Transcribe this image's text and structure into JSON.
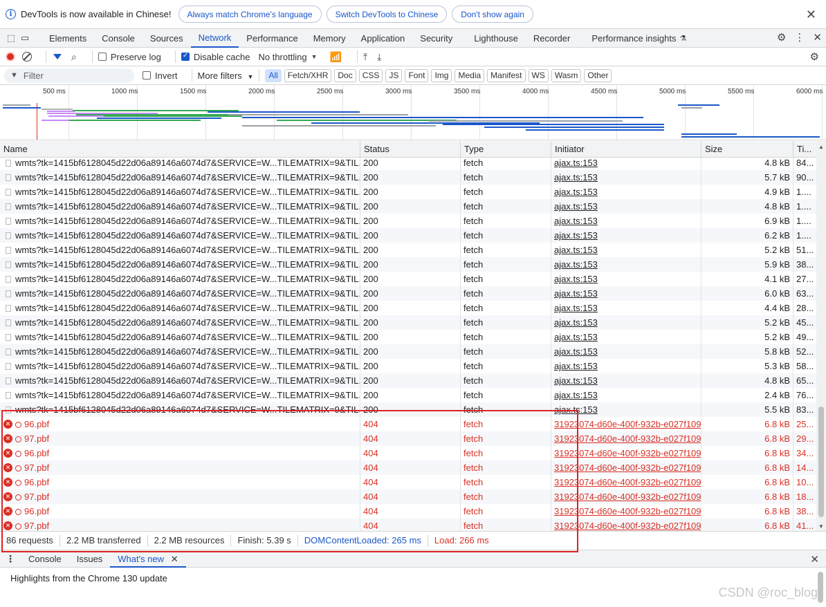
{
  "infobar": {
    "message": "DevTools is now available in Chinese!",
    "buttons": [
      "Always match Chrome's language",
      "Switch DevTools to Chinese",
      "Don't show again"
    ]
  },
  "main_tabs": [
    "Elements",
    "Console",
    "Sources",
    "Network",
    "Performance",
    "Memory",
    "Application",
    "Security",
    "Lighthouse",
    "Recorder",
    "Performance insights"
  ],
  "active_main_tab": "Network",
  "toolbar": {
    "preserve_log": "Preserve log",
    "preserve_log_checked": false,
    "disable_cache": "Disable cache",
    "disable_cache_checked": true,
    "throttling": "No throttling"
  },
  "filterbar": {
    "filter_placeholder": "Filter",
    "invert": "Invert",
    "more_filters": "More filters",
    "types": [
      "All",
      "Fetch/XHR",
      "Doc",
      "CSS",
      "JS",
      "Font",
      "Img",
      "Media",
      "Manifest",
      "WS",
      "Wasm",
      "Other"
    ],
    "active_type": "All"
  },
  "overview": {
    "ticks": [
      "500 ms",
      "1000 ms",
      "1500 ms",
      "2000 ms",
      "2500 ms",
      "3000 ms",
      "3500 ms",
      "4000 ms",
      "4500 ms",
      "5000 ms",
      "5500 ms",
      "6000 ms"
    ]
  },
  "table": {
    "columns": [
      "Name",
      "Status",
      "Type",
      "Initiator",
      "Size",
      "Ti..."
    ],
    "rows": [
      {
        "name": "wmts?tk=1415bf6128045d22d06a89146a6074d7&SERVICE=W...TILEMATRIX=9&TIL...",
        "status": "200",
        "type": "fetch",
        "initiator": "ajax.ts:153",
        "size": "4.8 kB",
        "time": "84...",
        "error": false
      },
      {
        "name": "wmts?tk=1415bf6128045d22d06a89146a6074d7&SERVICE=W...TILEMATRIX=9&TIL...",
        "status": "200",
        "type": "fetch",
        "initiator": "ajax.ts:153",
        "size": "5.7 kB",
        "time": "90...",
        "error": false
      },
      {
        "name": "wmts?tk=1415bf6128045d22d06a89146a6074d7&SERVICE=W...TILEMATRIX=9&TIL...",
        "status": "200",
        "type": "fetch",
        "initiator": "ajax.ts:153",
        "size": "4.9 kB",
        "time": "1....",
        "error": false
      },
      {
        "name": "wmts?tk=1415bf6128045d22d06a89146a6074d7&SERVICE=W...TILEMATRIX=9&TIL...",
        "status": "200",
        "type": "fetch",
        "initiator": "ajax.ts:153",
        "size": "4.8 kB",
        "time": "1....",
        "error": false
      },
      {
        "name": "wmts?tk=1415bf6128045d22d06a89146a6074d7&SERVICE=W...TILEMATRIX=9&TIL...",
        "status": "200",
        "type": "fetch",
        "initiator": "ajax.ts:153",
        "size": "6.9 kB",
        "time": "1....",
        "error": false
      },
      {
        "name": "wmts?tk=1415bf6128045d22d06a89146a6074d7&SERVICE=W...TILEMATRIX=9&TIL...",
        "status": "200",
        "type": "fetch",
        "initiator": "ajax.ts:153",
        "size": "6.2 kB",
        "time": "1....",
        "error": false
      },
      {
        "name": "wmts?tk=1415bf6128045d22d06a89146a6074d7&SERVICE=W...TILEMATRIX=9&TIL...",
        "status": "200",
        "type": "fetch",
        "initiator": "ajax.ts:153",
        "size": "5.2 kB",
        "time": "51...",
        "error": false
      },
      {
        "name": "wmts?tk=1415bf6128045d22d06a89146a6074d7&SERVICE=W...TILEMATRIX=9&TIL...",
        "status": "200",
        "type": "fetch",
        "initiator": "ajax.ts:153",
        "size": "5.9 kB",
        "time": "38...",
        "error": false
      },
      {
        "name": "wmts?tk=1415bf6128045d22d06a89146a6074d7&SERVICE=W...TILEMATRIX=9&TIL...",
        "status": "200",
        "type": "fetch",
        "initiator": "ajax.ts:153",
        "size": "4.1 kB",
        "time": "27...",
        "error": false
      },
      {
        "name": "wmts?tk=1415bf6128045d22d06a89146a6074d7&SERVICE=W...TILEMATRIX=9&TIL...",
        "status": "200",
        "type": "fetch",
        "initiator": "ajax.ts:153",
        "size": "6.0 kB",
        "time": "63...",
        "error": false
      },
      {
        "name": "wmts?tk=1415bf6128045d22d06a89146a6074d7&SERVICE=W...TILEMATRIX=9&TIL...",
        "status": "200",
        "type": "fetch",
        "initiator": "ajax.ts:153",
        "size": "4.4 kB",
        "time": "28...",
        "error": false
      },
      {
        "name": "wmts?tk=1415bf6128045d22d06a89146a6074d7&SERVICE=W...TILEMATRIX=9&TIL...",
        "status": "200",
        "type": "fetch",
        "initiator": "ajax.ts:153",
        "size": "5.2 kB",
        "time": "45...",
        "error": false
      },
      {
        "name": "wmts?tk=1415bf6128045d22d06a89146a6074d7&SERVICE=W...TILEMATRIX=9&TIL...",
        "status": "200",
        "type": "fetch",
        "initiator": "ajax.ts:153",
        "size": "5.2 kB",
        "time": "49...",
        "error": false
      },
      {
        "name": "wmts?tk=1415bf6128045d22d06a89146a6074d7&SERVICE=W...TILEMATRIX=9&TIL...",
        "status": "200",
        "type": "fetch",
        "initiator": "ajax.ts:153",
        "size": "5.8 kB",
        "time": "52...",
        "error": false
      },
      {
        "name": "wmts?tk=1415bf6128045d22d06a89146a6074d7&SERVICE=W...TILEMATRIX=9&TIL...",
        "status": "200",
        "type": "fetch",
        "initiator": "ajax.ts:153",
        "size": "5.3 kB",
        "time": "58...",
        "error": false
      },
      {
        "name": "wmts?tk=1415bf6128045d22d06a89146a6074d7&SERVICE=W...TILEMATRIX=9&TIL...",
        "status": "200",
        "type": "fetch",
        "initiator": "ajax.ts:153",
        "size": "4.8 kB",
        "time": "65...",
        "error": false
      },
      {
        "name": "wmts?tk=1415bf6128045d22d06a89146a6074d7&SERVICE=W...TILEMATRIX=9&TIL...",
        "status": "200",
        "type": "fetch",
        "initiator": "ajax.ts:153",
        "size": "2.4 kB",
        "time": "76...",
        "error": false
      },
      {
        "name": "wmts?tk=1415bf6128045d22d06a89146a6074d7&SERVICE=W...TILEMATRIX=9&TIL...",
        "status": "200",
        "type": "fetch",
        "initiator": "ajax.ts:153",
        "size": "5.5 kB",
        "time": "83...",
        "error": false
      },
      {
        "name": "96.pbf",
        "status": "404",
        "type": "fetch",
        "initiator": "31923074-d60e-400f-932b-e027f109",
        "size": "6.8 kB",
        "time": "25...",
        "error": true
      },
      {
        "name": "97.pbf",
        "status": "404",
        "type": "fetch",
        "initiator": "31923074-d60e-400f-932b-e027f109",
        "size": "6.8 kB",
        "time": "29...",
        "error": true
      },
      {
        "name": "96.pbf",
        "status": "404",
        "type": "fetch",
        "initiator": "31923074-d60e-400f-932b-e027f109",
        "size": "6.8 kB",
        "time": "34...",
        "error": true
      },
      {
        "name": "97.pbf",
        "status": "404",
        "type": "fetch",
        "initiator": "31923074-d60e-400f-932b-e027f109",
        "size": "6.8 kB",
        "time": "14...",
        "error": true
      },
      {
        "name": "96.pbf",
        "status": "404",
        "type": "fetch",
        "initiator": "31923074-d60e-400f-932b-e027f109",
        "size": "6.8 kB",
        "time": "10...",
        "error": true
      },
      {
        "name": "97.pbf",
        "status": "404",
        "type": "fetch",
        "initiator": "31923074-d60e-400f-932b-e027f109",
        "size": "6.8 kB",
        "time": "18...",
        "error": true
      },
      {
        "name": "96.pbf",
        "status": "404",
        "type": "fetch",
        "initiator": "31923074-d60e-400f-932b-e027f109",
        "size": "6.8 kB",
        "time": "38...",
        "error": true
      },
      {
        "name": "97.pbf",
        "status": "404",
        "type": "fetch",
        "initiator": "31923074-d60e-400f-932b-e027f109",
        "size": "6.8 kB",
        "time": "41...",
        "error": true
      }
    ]
  },
  "summary": {
    "requests": "86 requests",
    "transferred": "2.2 MB transferred",
    "resources": "2.2 MB resources",
    "finish": "Finish: 5.39 s",
    "dom_content_loaded": "DOMContentLoaded: 265 ms",
    "load": "Load: 266 ms"
  },
  "drawer": {
    "tabs": [
      "Console",
      "Issues",
      "What's new"
    ],
    "active_tab": "What's new",
    "highlight": "Highlights from the Chrome 130 update"
  },
  "watermark": "CSDN @roc_blog",
  "colors": {
    "accent": "#1a57c9",
    "error": "#d93025",
    "annotation": "#e02020"
  }
}
